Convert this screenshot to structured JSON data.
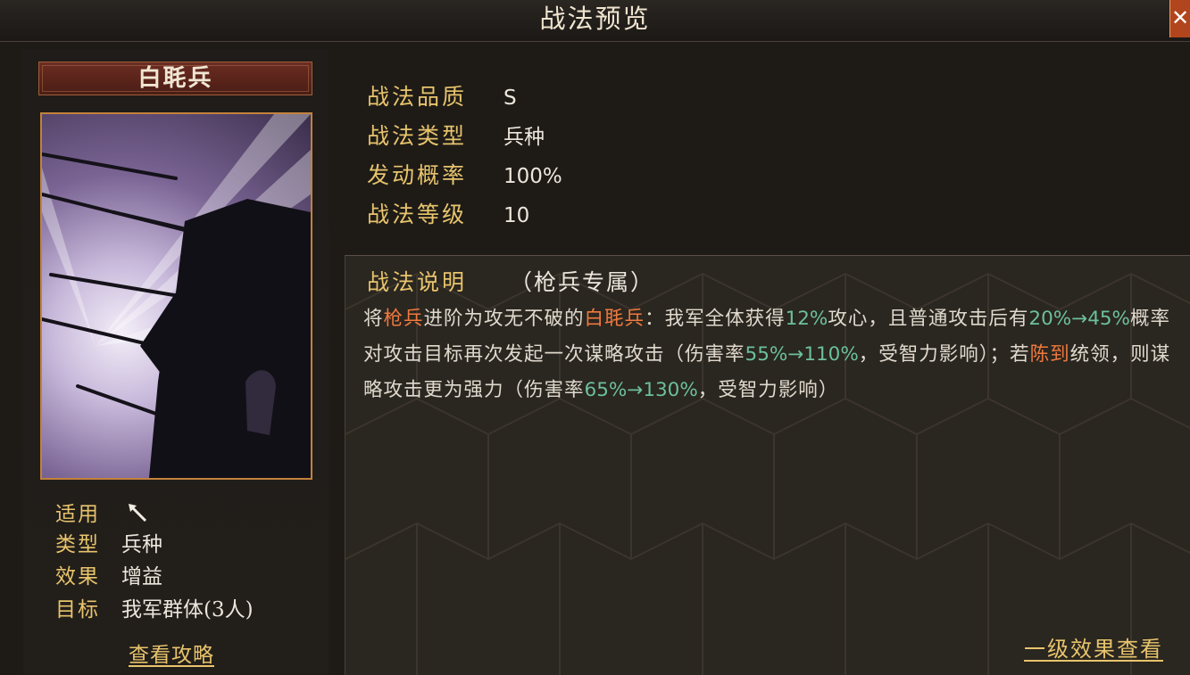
{
  "window": {
    "title": "战法预览",
    "close_icon": "close-icon"
  },
  "skill": {
    "name": "白毦兵",
    "applies_label": "适用",
    "applies_icon": "spear-icon",
    "type_label": "类型",
    "type_value": "兵种",
    "effect_label": "效果",
    "effect_value": "增益",
    "target_label": "目标",
    "target_value": "我军群体(3人)",
    "strategy_link": "查看攻略"
  },
  "properties": [
    {
      "label": "战法品质",
      "value": "S"
    },
    {
      "label": "战法类型",
      "value": "兵种"
    },
    {
      "label": "发动概率",
      "value": "100%"
    },
    {
      "label": "战法等级",
      "value": "10"
    }
  ],
  "description": {
    "title": "战法说明",
    "subtitle": "（枪兵专属）",
    "segments": [
      {
        "text": "将",
        "style": "normal"
      },
      {
        "text": "枪兵",
        "style": "orange"
      },
      {
        "text": "进阶为攻无不破的",
        "style": "normal"
      },
      {
        "text": "白毦兵",
        "style": "orange"
      },
      {
        "text": "：我军全体获得",
        "style": "normal"
      },
      {
        "text": "12%",
        "style": "green"
      },
      {
        "text": "攻心，且普通攻击后有",
        "style": "normal"
      },
      {
        "text": "20%→45%",
        "style": "green"
      },
      {
        "text": "概率对攻击目标再次发起一次谋略攻击（伤害率",
        "style": "normal"
      },
      {
        "text": "55%→110%",
        "style": "green"
      },
      {
        "text": "，受智力影响）；若",
        "style": "normal"
      },
      {
        "text": "陈到",
        "style": "orange"
      },
      {
        "text": "统领，则谋略攻击更为强力（伤害率",
        "style": "normal"
      },
      {
        "text": "65%→130%",
        "style": "green"
      },
      {
        "text": "，受智力影响）",
        "style": "normal"
      }
    ]
  },
  "level_effects_link": "一级效果查看",
  "colors": {
    "gold": "#e8c46c",
    "orange": "#f07a3e",
    "green": "#6cc09a",
    "close": "#b1461e"
  }
}
